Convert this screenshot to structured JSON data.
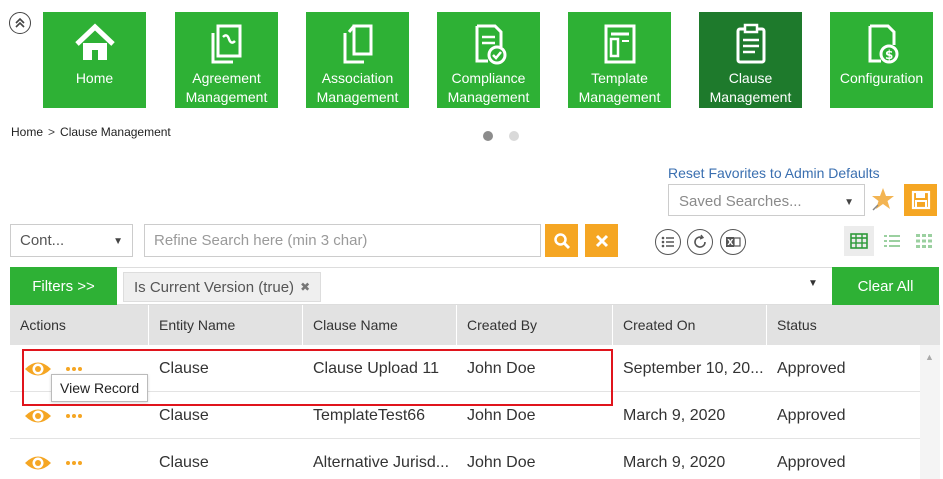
{
  "tiles": [
    {
      "label": "Home",
      "icon": "home-icon",
      "active": false
    },
    {
      "label": "Agreement Management",
      "icon": "agreement-icon",
      "active": false
    },
    {
      "label": "Association Management",
      "icon": "association-icon",
      "active": false
    },
    {
      "label": "Compliance Management",
      "icon": "compliance-icon",
      "active": false
    },
    {
      "label": "Template Management",
      "icon": "template-icon",
      "active": false
    },
    {
      "label": "Clause Management",
      "icon": "clause-icon",
      "active": true
    },
    {
      "label": "Configuration",
      "icon": "configuration-icon",
      "active": false
    }
  ],
  "breadcrumb": {
    "home": "Home",
    "separator": ">",
    "current": "Clause Management"
  },
  "carousel": {
    "pages": 2,
    "active_page": 1
  },
  "favorites": {
    "reset_label": "Reset Favorites to Admin Defaults",
    "saved_searches_placeholder": "Saved Searches..."
  },
  "search": {
    "context_value": "Cont...",
    "placeholder": "Refine Search here (min 3 char)"
  },
  "filters": {
    "button_label": "Filters >>",
    "chips": [
      "Is Current Version (true)"
    ],
    "clear_all_label": "Clear All"
  },
  "table": {
    "columns": [
      "Actions",
      "Entity Name",
      "Clause Name",
      "Created By",
      "Created On",
      "Status"
    ],
    "rows": [
      {
        "entity": "Clause",
        "clause": "Clause Upload 11",
        "created_by": "John Doe",
        "created_on": "September 10, 20...",
        "status": "Approved"
      },
      {
        "entity": "Clause",
        "clause": "TemplateTest66",
        "created_by": "John Doe",
        "created_on": "March 9, 2020",
        "status": "Approved"
      },
      {
        "entity": "Clause",
        "clause": "Alternative Jurisd...",
        "created_by": "John Doe",
        "created_on": "March 9, 2020",
        "status": "Approved"
      }
    ]
  },
  "tooltip": {
    "text": "View Record"
  },
  "colors": {
    "green": "#2eb135",
    "dark_green": "#1e7a2c",
    "orange": "#f5a623",
    "highlight_red": "#e0141c",
    "link_blue": "#3a6fb0"
  }
}
